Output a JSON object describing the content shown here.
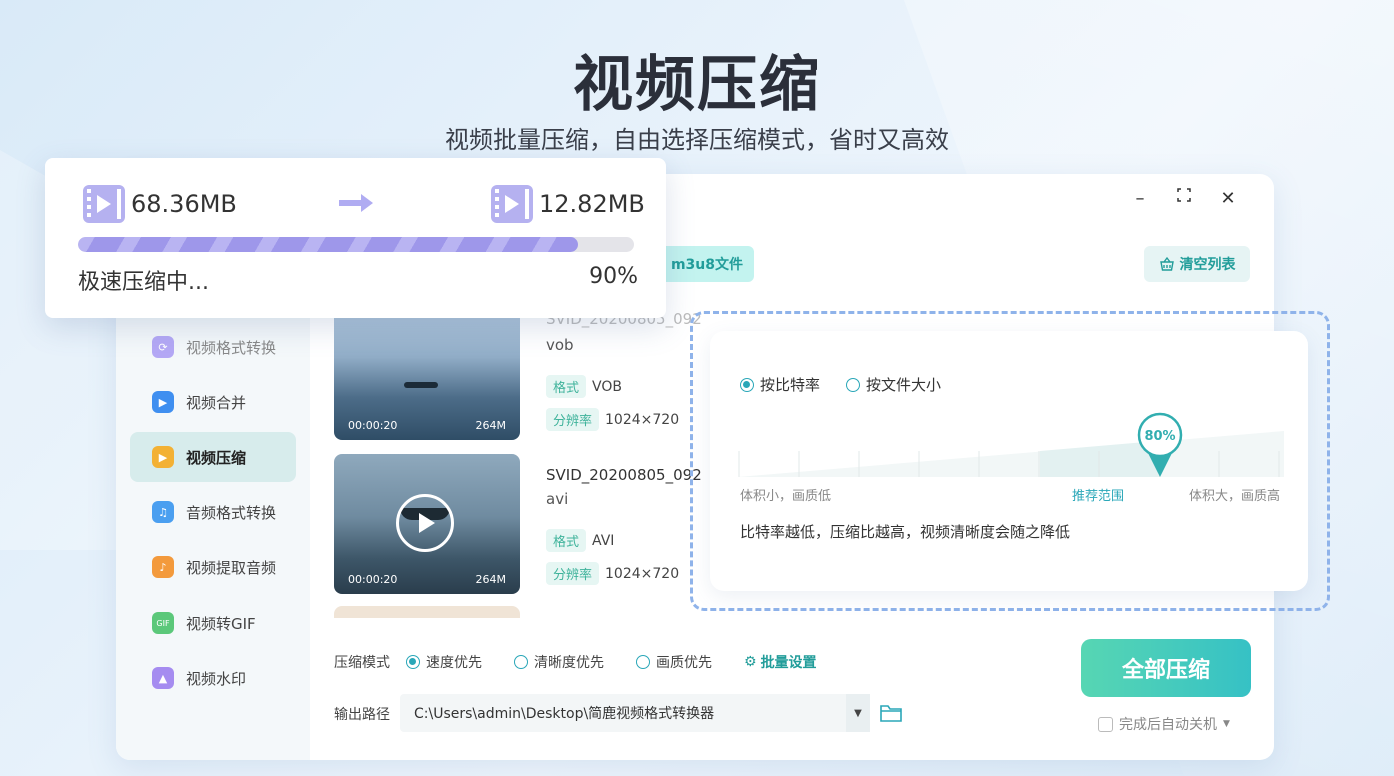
{
  "hero": {
    "title": "视频压缩",
    "subtitle": "视频批量压缩，自由选择压缩模式，省时又高效"
  },
  "window_controls": {
    "minimize": "–",
    "maximize": "⛶",
    "close": "✕"
  },
  "toolbar": {
    "add_m3u8_label": "m3u8文件",
    "clear_list_label": "清空列表"
  },
  "sidebar": {
    "items": [
      {
        "label": "视频格式转换",
        "icon": "video-convert-icon",
        "color": "#9b8cf0"
      },
      {
        "label": "视频合并",
        "icon": "video-merge-icon",
        "color": "#3f8ff0"
      },
      {
        "label": "视频压缩",
        "icon": "video-compress-icon",
        "color": "#f3b134",
        "active": true
      },
      {
        "label": "音频格式转换",
        "icon": "audio-convert-icon",
        "color": "#4a9ff0"
      },
      {
        "label": "视频提取音频",
        "icon": "extract-audio-icon",
        "color": "#f39a3c"
      },
      {
        "label": "视频转GIF",
        "icon": "gif-icon",
        "color": "#5bc87a"
      },
      {
        "label": "视频水印",
        "icon": "watermark-icon",
        "color": "#a58cf0"
      }
    ]
  },
  "files": [
    {
      "name_line1": "SVID_20200805_092",
      "name_line2": "vob",
      "duration": "00:00:20",
      "size": "264M",
      "format_tag": "格式",
      "format": "VOB",
      "res_tag": "分辨率",
      "resolution": "1024×720"
    },
    {
      "name_line1": "SVID_20200805_092",
      "name_line2": "avi",
      "duration": "00:00:20",
      "size": "264M",
      "format_tag": "格式",
      "format": "AVI",
      "res_tag": "分辨率",
      "resolution": "1024×720"
    }
  ],
  "compress_mode": {
    "label": "压缩模式",
    "options": [
      "速度优先",
      "清晰度优先",
      "画质优先"
    ],
    "selected": "速度优先",
    "batch_label": "批量设置"
  },
  "output": {
    "label": "输出路径",
    "path": "C:\\Users\\admin\\Desktop\\简鹿视频格式转换器"
  },
  "compress_all_label": "全部压缩",
  "auto_shutdown_label": "完成后自动关机",
  "progress": {
    "original_size": "68.36MB",
    "compressed_size": "12.82MB",
    "status": "极速压缩中...",
    "percent_text": "90%",
    "percent": 0.9
  },
  "bitrate": {
    "option_bitrate": "按比特率",
    "option_size": "按文件大小",
    "selected": "按比特率",
    "marker_text": "80%",
    "marker_value": 0.8,
    "left_label": "体积小，画质低",
    "mid_label": "推荐范围",
    "right_label": "体积大，画质高",
    "hint": "比特率越低，压缩比越高，视频清晰度会随之降低"
  },
  "colors": {
    "accent": "#2aa7b8",
    "primary_gradient_start": "#57d6b3",
    "primary_gradient_end": "#36c1c5",
    "progress": "#9e97ea"
  }
}
